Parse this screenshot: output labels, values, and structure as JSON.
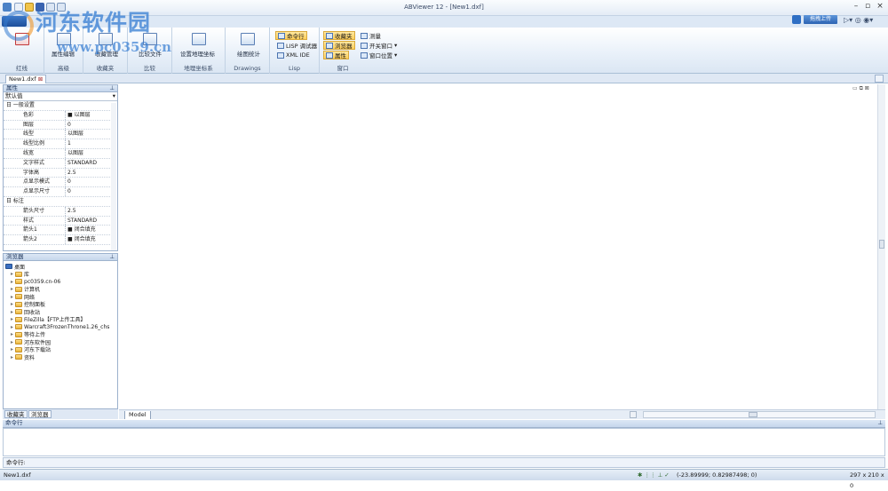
{
  "window": {
    "title": "ABViewer 12 - [New1.dxf]"
  },
  "watermark": {
    "line1": "河东软件园",
    "line2": "www.pc0359.cn"
  },
  "cloud_button": {
    "label": "拖拽上传"
  },
  "ribbon": {
    "groups": [
      {
        "label": "红线",
        "button": ""
      },
      {
        "label": "高级",
        "button": "属性编辑"
      },
      {
        "label": "收藏夹",
        "button": "收藏管理"
      },
      {
        "label": "比较",
        "button": "比较文件"
      },
      {
        "label": "地理坐标系",
        "button": "设置地理坐标"
      },
      {
        "label": "Drawings",
        "button": "绘图统计"
      },
      {
        "label": "Lisp",
        "items": [
          "命令行",
          "LISP 调试器",
          "XML IDE"
        ]
      },
      {
        "label": "窗口",
        "items_a": [
          "收藏夹",
          "浏览器",
          "属性"
        ],
        "items_b": [
          "测量",
          "开关窗口",
          "窗口位置"
        ]
      }
    ]
  },
  "doc_tab": {
    "label": "New1.dxf"
  },
  "props": {
    "header": "属性",
    "selector": "默认值",
    "rows": [
      {
        "k": "日 一般设置",
        "v": "",
        "cat": true
      },
      {
        "k": "色彩",
        "v": "■ 以图层"
      },
      {
        "k": "图层",
        "v": "0"
      },
      {
        "k": "线型",
        "v": "以图层"
      },
      {
        "k": "线型比例",
        "v": "1"
      },
      {
        "k": "线宽",
        "v": "以图层"
      },
      {
        "k": "文字样式",
        "v": "STANDARD"
      },
      {
        "k": "字体高",
        "v": "2.5"
      },
      {
        "k": "点显示模式",
        "v": "0"
      },
      {
        "k": "点显示尺寸",
        "v": "0"
      },
      {
        "k": "日 标注",
        "v": "",
        "cat": true
      },
      {
        "k": "箭头尺寸",
        "v": "2.5"
      },
      {
        "k": "样式",
        "v": "STANDARD"
      },
      {
        "k": "箭头1",
        "v": "■ 闭合填充"
      },
      {
        "k": "箭头2",
        "v": "■ 闭合填充"
      }
    ]
  },
  "browser": {
    "header": "浏览器",
    "items": [
      "桌面",
      "库",
      "pc0359.cn-06",
      "计算机",
      "网络",
      "控制面板",
      "回收站",
      "FileZilla【FTP上传工具】",
      "Warcraft3FrozenThrone1.26_chs",
      "等待上传",
      "河东软件园",
      "河东下载站",
      "资料"
    ],
    "tabs": [
      "收藏夹",
      "浏览器"
    ]
  },
  "layout_tab": {
    "label": "Model"
  },
  "command": {
    "header": "命令行",
    "prompt": "命令行:"
  },
  "status": {
    "file": "New1.dxf",
    "coords": "(-23.89999; 0.82987498; 0)",
    "size": "297 x 210 x 0"
  }
}
